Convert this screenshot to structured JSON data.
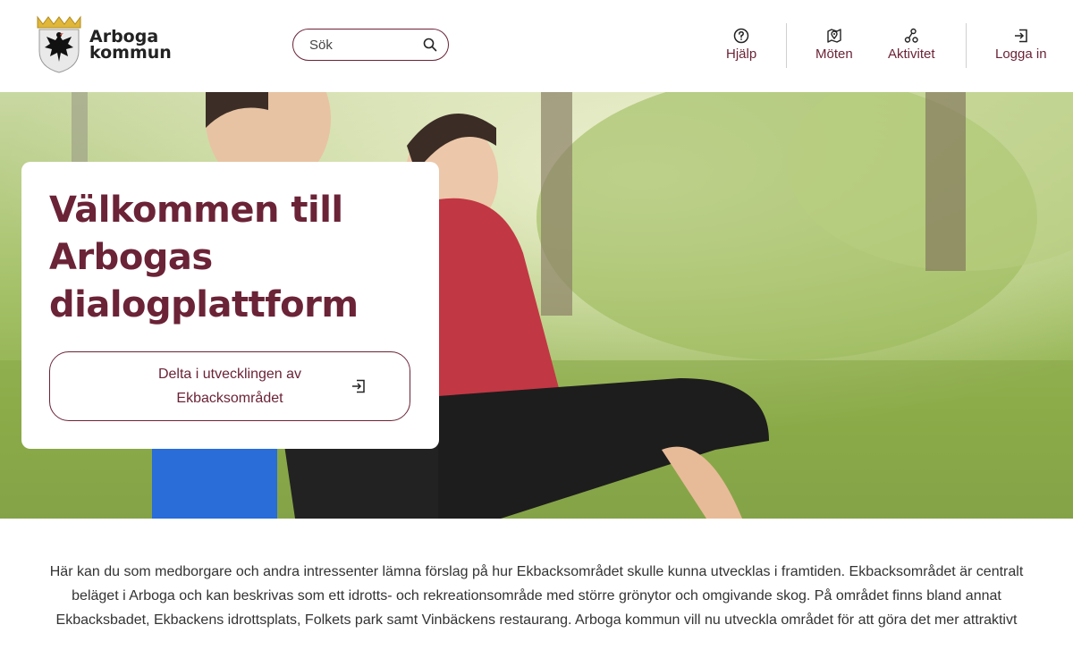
{
  "brand": {
    "name_line1": "Arboga",
    "name_line2": "kommun"
  },
  "search": {
    "placeholder": "Sök"
  },
  "nav": {
    "help": "Hjälp",
    "meetings": "Möten",
    "activity": "Aktivitet",
    "login": "Logga in"
  },
  "hero": {
    "title": "Välkommen till Arbogas dialogplattform",
    "cta_label": "Delta i utvecklingen av Ekbacksområdet"
  },
  "intro": {
    "text": "Här kan du som medborgare och andra intressenter lämna förslag på hur Ekbacksområdet skulle kunna utvecklas i framtiden. Ekbacksområdet är centralt beläget i Arboga och kan beskrivas som ett idrotts- och rekreationsområde med större grönytor och omgivande skog. På området finns bland annat Ekbacksbadet, Ekbackens idrottsplats, Folkets park samt Vinbäckens restaurang. Arboga kommun vill nu utveckla området för att göra det mer attraktivt"
  },
  "colors": {
    "accent": "#6b2337",
    "divider": "#cfcfcf"
  }
}
